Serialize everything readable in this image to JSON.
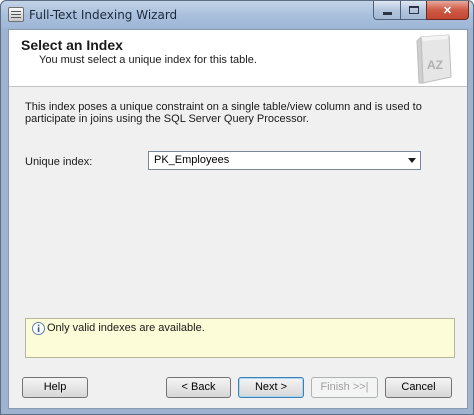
{
  "window": {
    "title": "Full-Text Indexing Wizard",
    "icon": "wizard-app-icon"
  },
  "header": {
    "title": "Select an Index",
    "subtitle": "You must select a unique index for this table.",
    "icon": "book-az-icon",
    "icon_text": "AZ"
  },
  "body": {
    "description": "This index poses a unique constraint on a single table/view column and is used to participate in joins using the SQL Server Query Processor.",
    "unique_index_label": "Unique index:",
    "unique_index_value": "PK_Employees"
  },
  "message": {
    "icon": "info-icon",
    "text": "Only valid indexes are available."
  },
  "buttons": {
    "help": "Help",
    "back": "< Back",
    "next": "Next >",
    "finish": "Finish >>|",
    "cancel": "Cancel"
  },
  "colors": {
    "message_background": "#fcfcd9",
    "client_background": "#f0f0f0",
    "close_button": "#c24631"
  }
}
